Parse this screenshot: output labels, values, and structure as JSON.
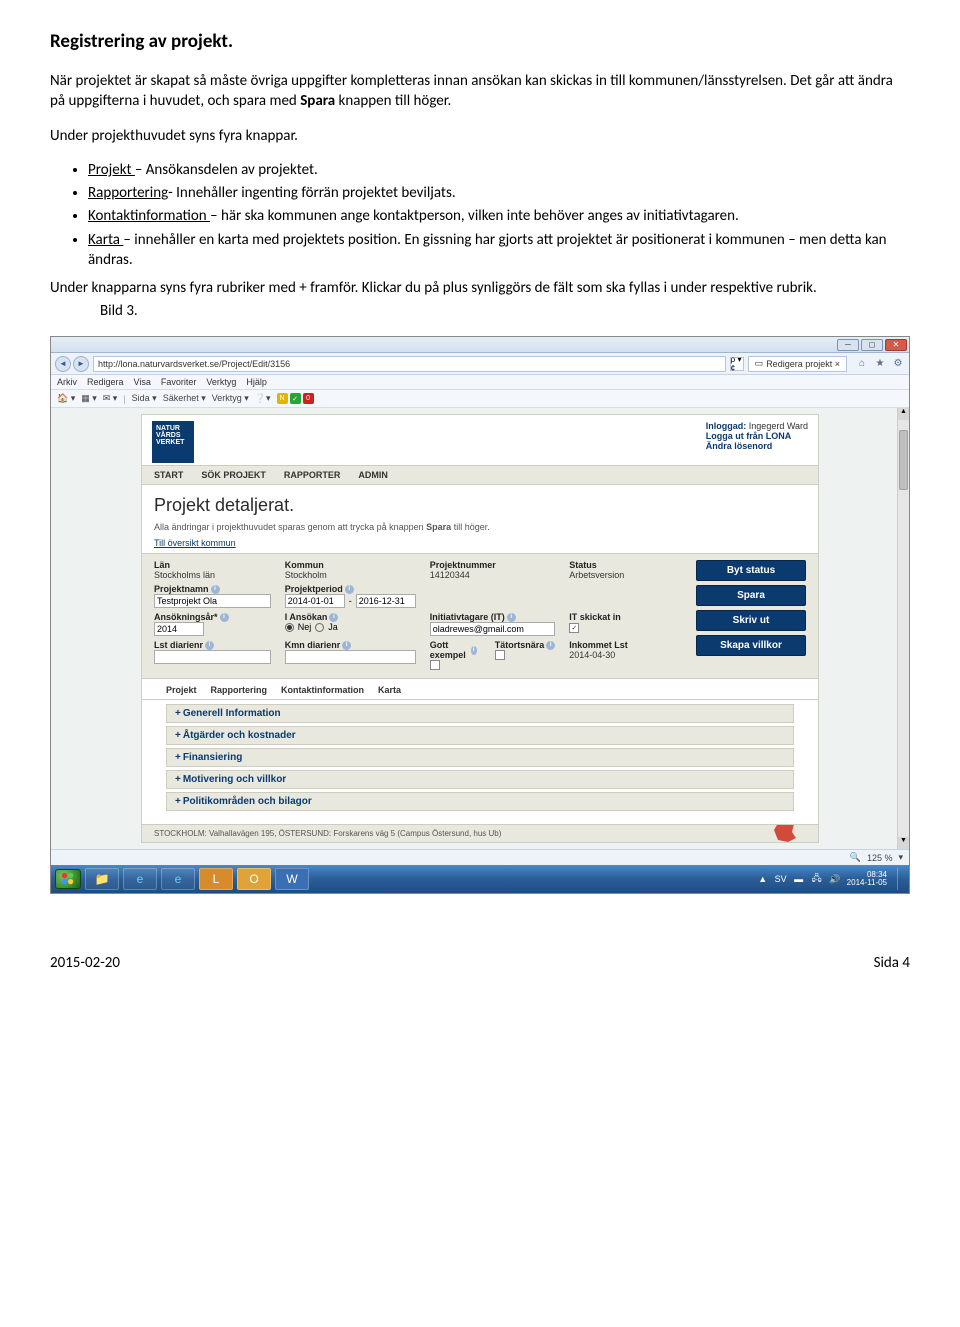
{
  "doc": {
    "title": "Registrering av projekt.",
    "p1_a": "När projektet är skapat så måste övriga uppgifter kompletteras innan ansökan kan skickas in till kommunen/länsstyrelsen. Det går att ändra på uppgifterna i huvudet, och spara med ",
    "p1_b": "Spara",
    "p1_c": " knappen till höger.",
    "p2": "Under projekthuvudet syns fyra knappar.",
    "b1_u": "Projekt ",
    "b1_r": "– Ansökansdelen av projektet.",
    "b2_u": "Rapportering",
    "b2_r": "- Innehåller ingenting förrän projektet beviljats.",
    "b3_u": "Kontaktinformation ",
    "b3_r": "– här ska kommunen ange kontaktperson, vilken inte behöver anges av initiativtagaren.",
    "b4_u": "Karta ",
    "b4_r": "– innehåller en karta med projektets position. En gissning har gjorts att projektet är positionerat i kommunen – men detta kan ändras.",
    "after": "Under knapparna syns fyra rubriker med + framför. Klickar du på plus synliggörs de fält som ska fyllas i under respektive rubrik.",
    "bild": "Bild 3."
  },
  "browser": {
    "url": "http://lona.naturvardsverket.se/Project/Edit/3156",
    "search_hint": "ρ ▾ ¢",
    "tab": "Redigera projekt",
    "menu": [
      "Arkiv",
      "Redigera",
      "Visa",
      "Favoriter",
      "Verktyg",
      "Hjälp"
    ],
    "toolbar": {
      "sida": "Sida ▾",
      "sakerhet": "Säkerhet ▾",
      "verktyg": "Verktyg ▾"
    },
    "zoom": "125 %"
  },
  "page": {
    "logo": "NATUR\nVÅRDS\nVERKET",
    "login_label": "Inloggad:",
    "login_user": "Ingegerd Ward",
    "logout": "Logga ut från LONA",
    "changepw": "Ändra lösenord",
    "nav": [
      "START",
      "SÖK PROJEKT",
      "RAPPORTER",
      "ADMIN"
    ],
    "h2": "Projekt detaljerat.",
    "sub_a": "Alla ändringar i projekthuvudet sparas genom att trycka på knappen ",
    "sub_b": "Spara",
    "sub_c": " till höger.",
    "back": "Till översikt kommun",
    "fields": {
      "lan_l": "Län",
      "lan_v": "Stockholms län",
      "kom_l": "Kommun",
      "kom_v": "Stockholm",
      "pnr_l": "Projektnummer",
      "pnr_v": "14120344",
      "stat_l": "Status",
      "stat_v": "Arbetsversion",
      "pname_l": "Projektnamn",
      "pname_v": "Testprojekt Ola",
      "pper_l": "Projektperiod",
      "pper_a": "2014-01-01",
      "pper_b": "2016-12-31",
      "ansar_l": "Ansökningsår*",
      "ansar_v": "2014",
      "ians_l": "I Ansökan",
      "nej": "Nej",
      "ja": "Ja",
      "it_l": "Initiativtagare (IT)",
      "it_v": "oladrewes@gmail.com",
      "itsk_l": "IT skickat in",
      "lstd_l": "Lst diarienr",
      "kmnd_l": "Kmn diarienr",
      "gott_l": "Gott exempel",
      "tat_l": "Tätortsnära",
      "ink_l": "Inkommet Lst",
      "ink_v": "2014-04-30"
    },
    "buttons": [
      "Byt status",
      "Spara",
      "Skriv ut",
      "Skapa villkor"
    ],
    "tabs": [
      "Projekt",
      "Rapportering",
      "Kontaktinformation",
      "Karta"
    ],
    "acc": [
      "Generell Information",
      "Åtgärder och kostnader",
      "Finansiering",
      "Motivering och villkor",
      "Politikområden och bilagor"
    ],
    "footer_addr": "STOCKHOLM: Valhallavägen 195, ÖSTERSUND: Forskarens väg 5 (Campus Östersund, hus Ub)"
  },
  "taskbar": {
    "lang": "SV",
    "time": "08:34",
    "date": "2014-11-05"
  },
  "footer": {
    "left": "2015-02-20",
    "right": "Sida 4"
  }
}
